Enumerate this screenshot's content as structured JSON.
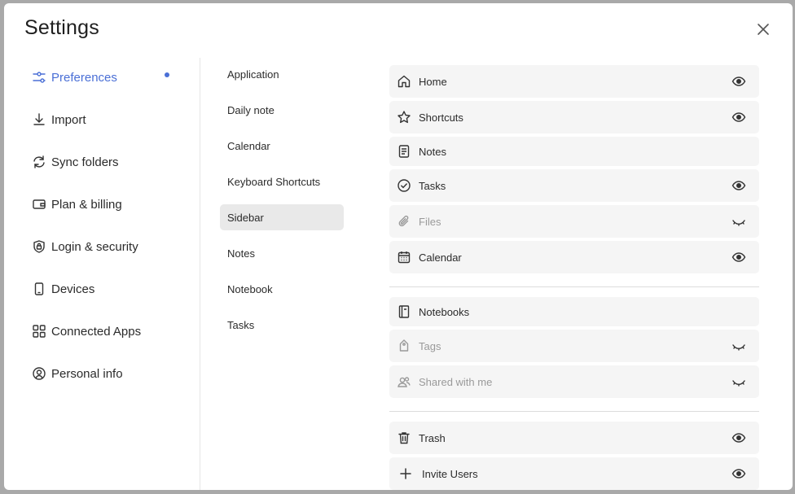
{
  "dialog": {
    "title": "Settings"
  },
  "nav": {
    "items": [
      {
        "label": "Preferences",
        "icon": "sliders-icon",
        "active": true
      },
      {
        "label": "Import",
        "icon": "download-icon"
      },
      {
        "label": "Sync folders",
        "icon": "sync-icon"
      },
      {
        "label": "Plan & billing",
        "icon": "wallet-icon"
      },
      {
        "label": "Login & security",
        "icon": "shield-lock-icon"
      },
      {
        "label": "Devices",
        "icon": "phone-icon"
      },
      {
        "label": "Connected Apps",
        "icon": "apps-grid-icon"
      },
      {
        "label": "Personal info",
        "icon": "user-circle-icon"
      }
    ]
  },
  "subnav": {
    "items": [
      {
        "label": "Application"
      },
      {
        "label": "Daily note"
      },
      {
        "label": "Calendar"
      },
      {
        "label": "Keyboard Shortcuts"
      },
      {
        "label": "Sidebar",
        "active": true
      },
      {
        "label": "Notes"
      },
      {
        "label": "Notebook"
      },
      {
        "label": "Tasks"
      }
    ]
  },
  "sidebar_items": {
    "group1": [
      {
        "label": "Home",
        "icon": "home-icon",
        "visibility": "visible"
      },
      {
        "label": "Shortcuts",
        "icon": "star-icon",
        "visibility": "visible"
      },
      {
        "label": "Notes",
        "icon": "note-icon",
        "visibility": "none"
      },
      {
        "label": "Tasks",
        "icon": "check-circle-icon",
        "visibility": "visible"
      },
      {
        "label": "Files",
        "icon": "paperclip-icon",
        "visibility": "hidden"
      },
      {
        "label": "Calendar",
        "icon": "calendar-icon",
        "visibility": "visible"
      }
    ],
    "group2": [
      {
        "label": "Notebooks",
        "icon": "notebook-icon",
        "visibility": "none"
      },
      {
        "label": "Tags",
        "icon": "tag-icon",
        "visibility": "hidden"
      },
      {
        "label": "Shared with me",
        "icon": "users-icon",
        "visibility": "hidden"
      }
    ],
    "group3": [
      {
        "label": "Trash",
        "icon": "trash-icon",
        "visibility": "visible"
      },
      {
        "label": "Invite Users",
        "icon": "plus-icon",
        "visibility": "visible"
      }
    ]
  },
  "colors": {
    "accent": "#4a6fd6",
    "row_bg": "#f5f5f5",
    "active_bg": "#e9e9e9"
  }
}
